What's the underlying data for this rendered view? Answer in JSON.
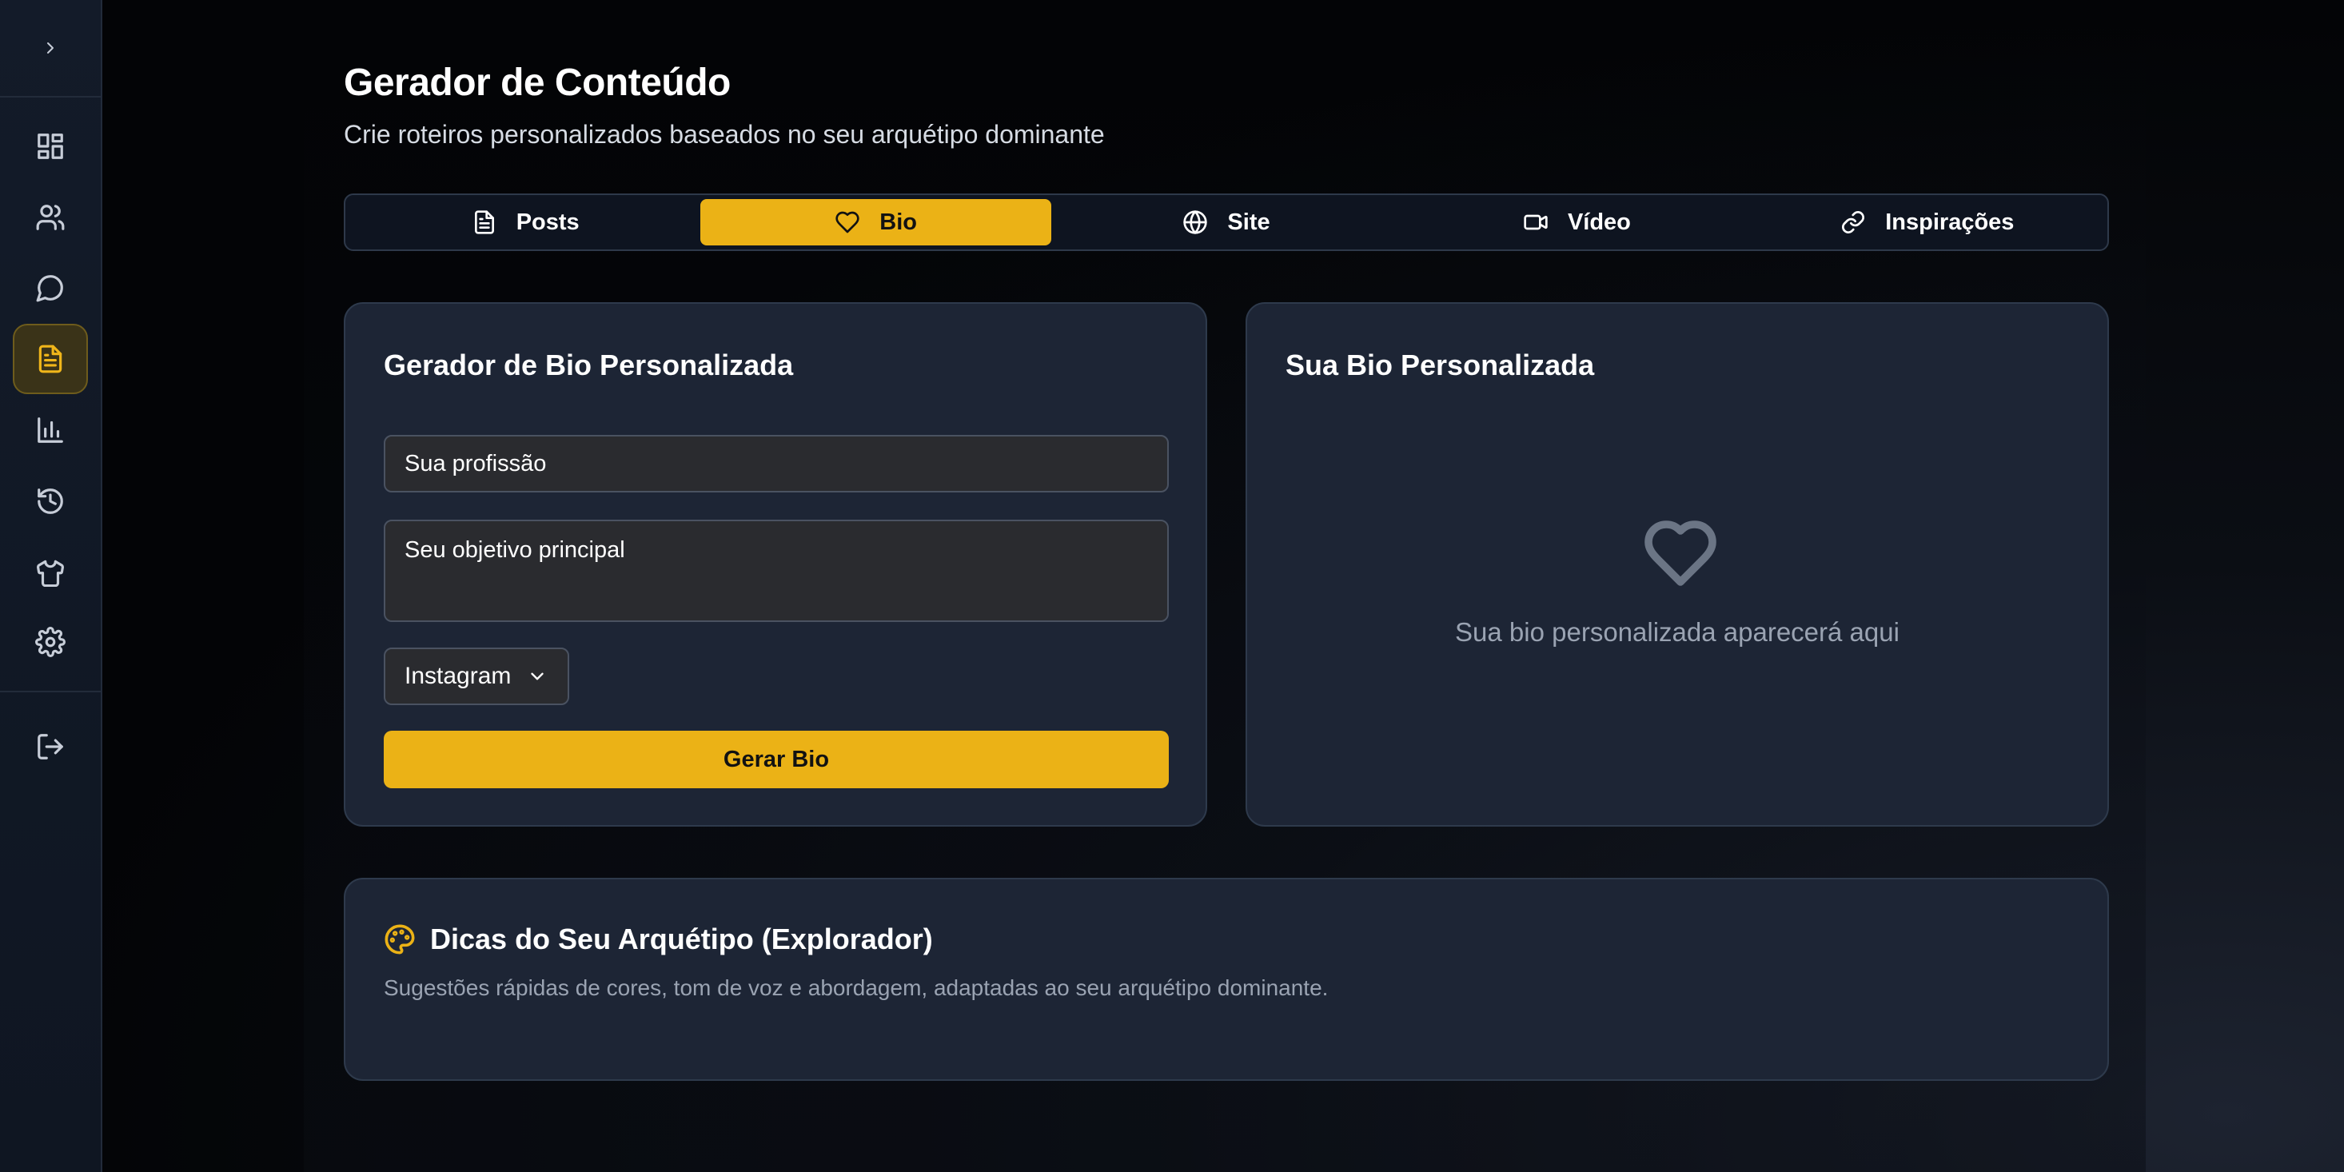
{
  "header": {
    "title": "Gerador de Conteúdo",
    "subtitle": "Crie roteiros personalizados baseados no seu arquétipo dominante"
  },
  "sidebar": {
    "items": [
      {
        "icon": "dashboard-icon"
      },
      {
        "icon": "users-icon"
      },
      {
        "icon": "chat-icon"
      },
      {
        "icon": "document-icon",
        "active": true
      },
      {
        "icon": "chart-icon"
      },
      {
        "icon": "history-icon"
      },
      {
        "icon": "shirt-icon"
      },
      {
        "icon": "gear-icon"
      },
      {
        "icon": "logout-icon"
      }
    ]
  },
  "tabs": [
    {
      "label": "Posts",
      "icon": "document-icon"
    },
    {
      "label": "Bio",
      "icon": "heart-icon",
      "active": true
    },
    {
      "label": "Site",
      "icon": "globe-icon"
    },
    {
      "label": "Vídeo",
      "icon": "video-icon"
    },
    {
      "label": "Inspirações",
      "icon": "link-icon"
    }
  ],
  "generator": {
    "title": "Gerador de Bio Personalizada",
    "profession_placeholder": "Sua profissão",
    "goal_placeholder": "Seu objetivo principal",
    "platform": "Instagram",
    "submit_label": "Gerar Bio"
  },
  "result": {
    "title": "Sua Bio Personalizada",
    "empty_text": "Sua bio personalizada aparecerá aqui"
  },
  "tips": {
    "title": "Dicas do Seu Arquétipo (Explorador)",
    "description": "Sugestões rápidas de cores, tom de voz e abordagem, adaptadas ao seu arquétipo dominante."
  },
  "colors": {
    "accent": "#ebb216",
    "card": "#1d2535",
    "background": "#05070b"
  }
}
